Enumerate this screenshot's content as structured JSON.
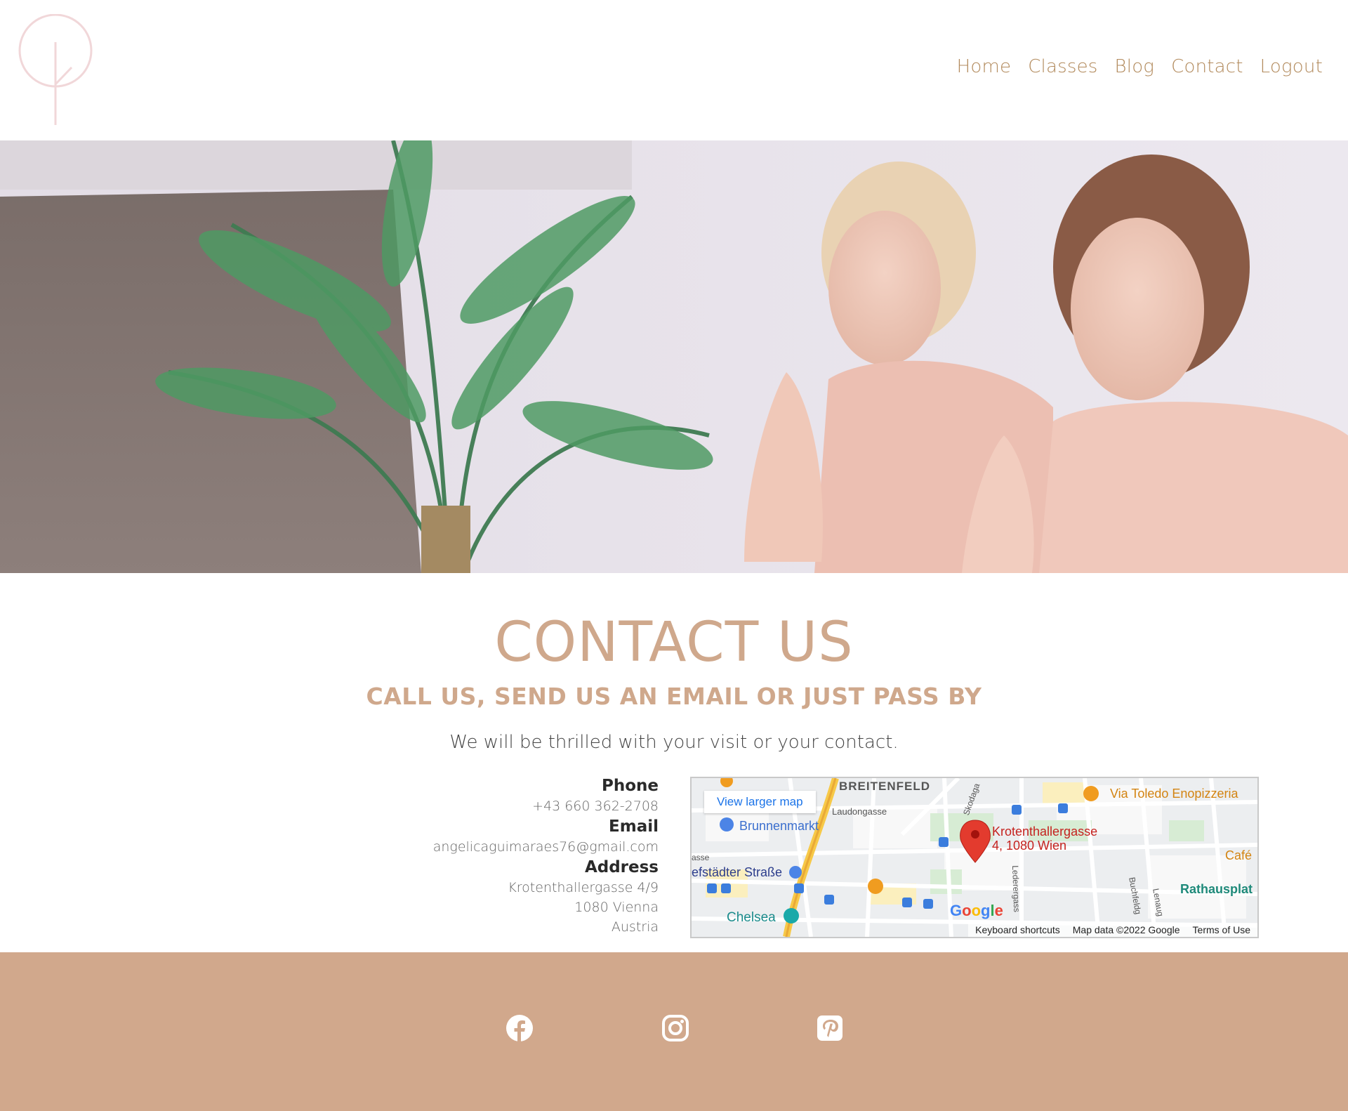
{
  "nav": {
    "items": [
      "Home",
      "Classes",
      "Blog",
      "Contact",
      "Logout"
    ]
  },
  "contact": {
    "title": "CONTACT US",
    "subtitle": "CALL US, SEND US AN EMAIL OR JUST PASS BY",
    "intro": "We will be thrilled with your visit or your contact.",
    "phone_label": "Phone",
    "phone": "+43 660 362-2708",
    "email_label": "Email",
    "email": "angelicaguimaraes76@gmail.com",
    "address_label": "Address",
    "address_line1": "Krotenthallergasse 4/9",
    "address_line2": "1080 Vienna",
    "address_line3": "Austria"
  },
  "map": {
    "view_larger": "View larger map",
    "google": "Google",
    "keyboard_shortcuts": "Keyboard shortcuts",
    "map_data": "Map data ©2022 Google",
    "terms": "Terms of Use",
    "marker_line1": "Krotenthallergasse",
    "marker_line2": "4, 1080 Wien",
    "labels": {
      "breitenfeld": "BREITENFELD",
      "laudongasse": "Laudongasse",
      "brunnenmarkt": "Brunnenmarkt",
      "via_toledo": "Via Toledo Enopizzeria",
      "cafe": "Café",
      "rathausplat": "Rathausplat",
      "josefstaedter": "efstädter Straße",
      "chelsea": "Chelsea",
      "skodagasse": "Skodaga",
      "lederergasse": "Lederergass",
      "buchfeld": "Buchfeldg",
      "lenau": "Lenaug",
      "gasse": "asse"
    }
  },
  "colors": {
    "accent": "#cfa88c",
    "nav": "#b28a5c",
    "footer": "#d1a88c"
  },
  "footer": {
    "icons": [
      "facebook-icon",
      "instagram-icon",
      "pinterest-icon"
    ]
  }
}
